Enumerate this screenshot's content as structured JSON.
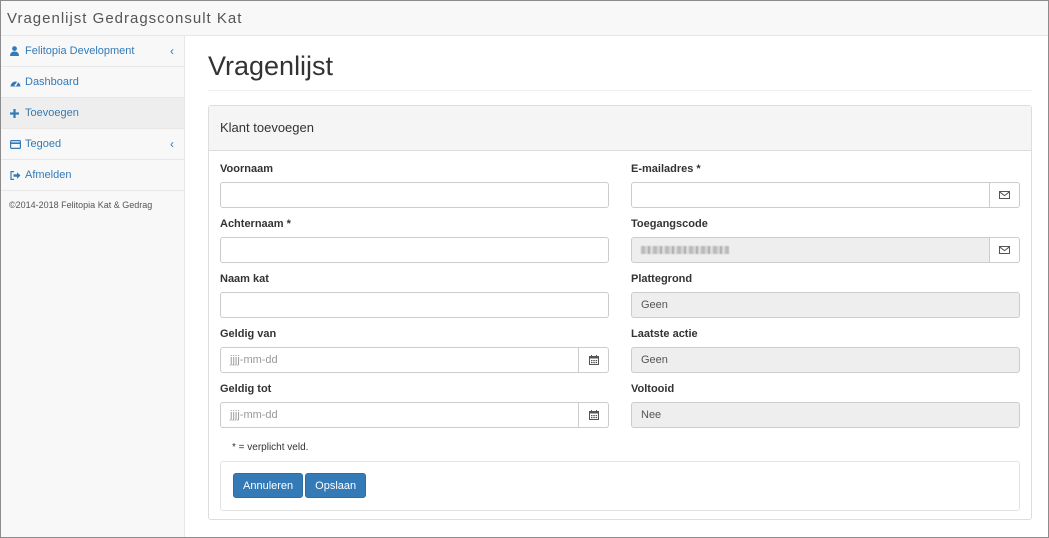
{
  "app": {
    "title": "Vragenlijst Gedragsconsult Kat"
  },
  "sidebar": {
    "items": [
      {
        "label": "Felitopia Development",
        "icon": "user-icon",
        "has_chevron": true
      },
      {
        "label": "Dashboard",
        "icon": "dashboard-icon"
      },
      {
        "label": "Toevoegen",
        "icon": "plus-icon",
        "active": true
      },
      {
        "label": "Tegoed",
        "icon": "credit-card-icon",
        "has_chevron": true
      },
      {
        "label": "Afmelden",
        "icon": "sign-out-icon"
      }
    ],
    "chevron": "‹",
    "copyright": "©2014-2018 Felitopia Kat & Gedrag"
  },
  "page": {
    "title": "Vragenlijst"
  },
  "panel": {
    "heading": "Klant toevoegen"
  },
  "form": {
    "voornaam": {
      "label": "Voornaam",
      "value": ""
    },
    "achternaam": {
      "label": "Achternaam *",
      "value": ""
    },
    "naam_kat": {
      "label": "Naam kat",
      "value": ""
    },
    "geldig_van": {
      "label": "Geldig van",
      "placeholder": "jjjj-mm-dd"
    },
    "geldig_tot": {
      "label": "Geldig tot",
      "placeholder": "jjjj-mm-dd"
    },
    "email": {
      "label": "E-mailadres *",
      "value": ""
    },
    "toegangscode": {
      "label": "Toegangscode"
    },
    "plattegrond": {
      "label": "Plattegrond",
      "value": "Geen"
    },
    "laatste_actie": {
      "label": "Laatste actie",
      "value": "Geen"
    },
    "voltooid": {
      "label": "Voltooid",
      "value": "Nee"
    },
    "required_note": "* = verplicht veld."
  },
  "buttons": {
    "cancel": "Annuleren",
    "save": "Opslaan"
  },
  "colors": {
    "link": "#337ab7",
    "primary": "#337ab7"
  }
}
